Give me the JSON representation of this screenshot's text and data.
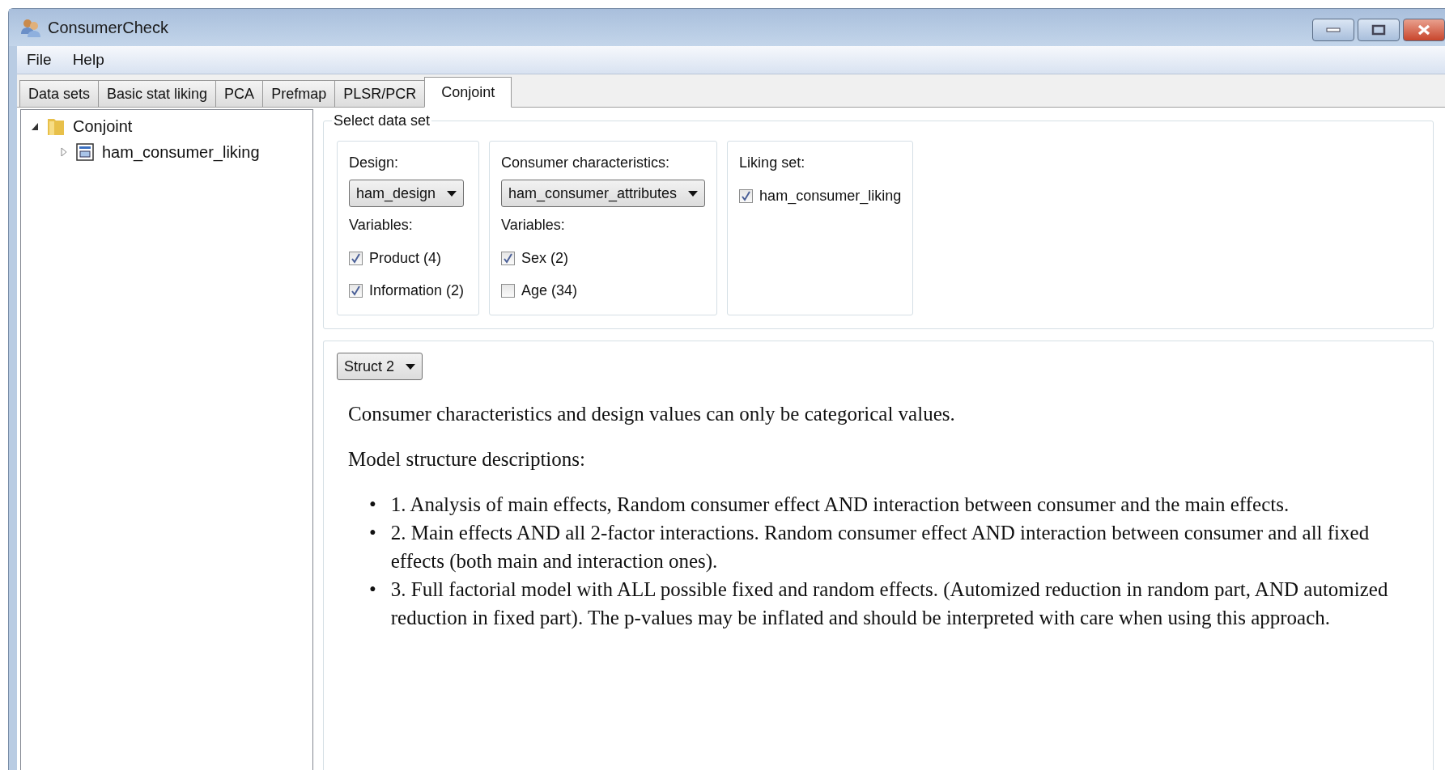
{
  "window": {
    "title": "ConsumerCheck"
  },
  "menu": [
    "File",
    "Help"
  ],
  "tabs": [
    {
      "label": "Data sets",
      "selected": false
    },
    {
      "label": "Basic stat liking",
      "selected": false
    },
    {
      "label": "PCA",
      "selected": false
    },
    {
      "label": "Prefmap",
      "selected": false
    },
    {
      "label": "PLSR/PCR",
      "selected": false
    },
    {
      "label": "Conjoint",
      "selected": true
    }
  ],
  "tree": [
    {
      "label": "Conjoint",
      "kind": "folder",
      "expanded": true,
      "children": [
        {
          "label": "ham_consumer_liking",
          "kind": "dataset",
          "expanded": false
        }
      ]
    }
  ],
  "select_data_set": {
    "title": "Select data set",
    "groups": [
      {
        "label": "Design:",
        "dropdown": "ham_design",
        "variables_label": "Variables:",
        "checkboxes": [
          {
            "label": "Product (4)",
            "checked": true
          },
          {
            "label": "Information (2)",
            "checked": true
          }
        ]
      },
      {
        "label": "Consumer characteristics:",
        "dropdown": "ham_consumer_attributes",
        "variables_label": "Variables:",
        "checkboxes": [
          {
            "label": "Sex (2)",
            "checked": true
          },
          {
            "label": "Age (34)",
            "checked": false
          }
        ]
      },
      {
        "label": "Liking set:",
        "checkboxes": [
          {
            "label": "ham_consumer_liking",
            "checked": true
          }
        ]
      }
    ]
  },
  "structure_dropdown": "Struct 2",
  "description": {
    "intro": "Consumer characteristics and design values can only be categorical values.",
    "heading": "Model structure descriptions:",
    "bullets": [
      {
        "marker": "•",
        "text": "1. Analysis of main effects, Random consumer effect AND interaction between consumer and the main effects."
      },
      {
        "marker": "•",
        "text": "2. Main effects AND all 2-factor interactions. Random consumer effect AND interaction between consumer and all fixed effects (both main and interaction ones)."
      },
      {
        "marker": "•",
        "text": "3. Full factorial model with ALL possible fixed and random effects. (Automized reduction in random part, AND automized reduction in fixed part). The p-values may be inflated and should be interpreted with care when using this approach."
      }
    ]
  }
}
